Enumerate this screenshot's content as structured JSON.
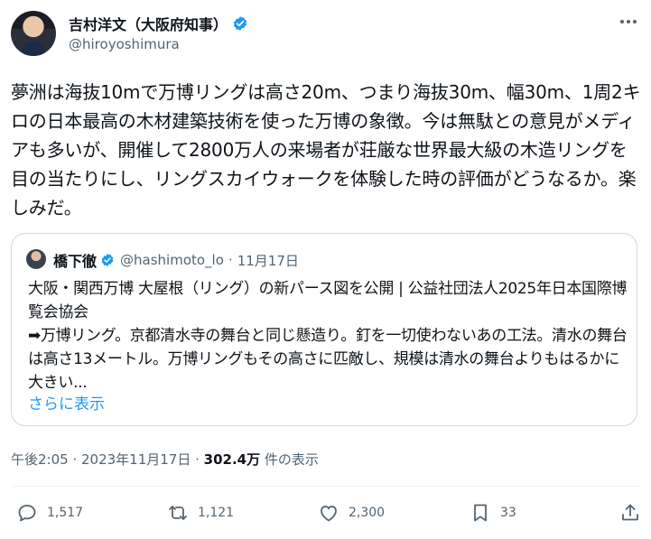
{
  "author": {
    "display_name": "吉村洋文（大阪府知事）",
    "handle": "@hiroyoshimura"
  },
  "tweet": {
    "text": "夢洲は海抜10mで万博リングは高さ20m、つまり海抜30m、幅30m、1周2キロの日本最高の木材建築技術を使った万博の象徴。今は無駄との意見がメディアも多いが、開催して2800万人の来場者が荘厳な世界最大級の木造リングを目の当たりにし、リングスカイウォークを体験した時の評価がどうなるか。楽しみだ。"
  },
  "quote": {
    "display_name": "橋下徹",
    "handle": "@hashimoto_lo",
    "separator": "·",
    "date": "11月17日",
    "text": "大阪・関西万博 大屋根（リング）の新パース図を公開 | 公益社団法人2025年日本国際博覧会協会\n➡万博リング。京都清水寺の舞台と同じ懸造り。釘を一切使わないあの工法。清水の舞台は高さ13メートル。万博リングもその高さに匹敵し、規模は清水の舞台よりもはるかに大きい...",
    "show_more": "さらに表示"
  },
  "meta": {
    "timestamp": "午後2:05 · 2023年11月17日",
    "separator": " · ",
    "views_count": "302.4万",
    "views_label": " 件の表示"
  },
  "actions": {
    "replies": "1,517",
    "retweets": "1,121",
    "likes": "2,300",
    "bookmarks": "33"
  },
  "colors": {
    "accent": "#1d9bf0",
    "secondary_text": "#536471",
    "border": "#cfd9de"
  }
}
